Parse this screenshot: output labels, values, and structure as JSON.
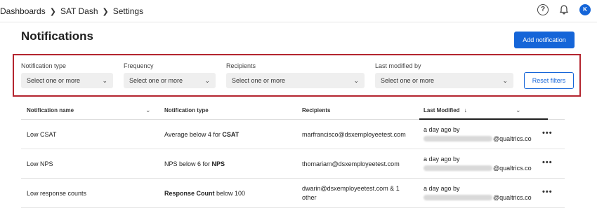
{
  "breadcrumb": {
    "items": [
      "Dashboards",
      "SAT Dash",
      "Settings"
    ]
  },
  "header_icons": {
    "help": "question-circle-icon",
    "bell": "bell-icon",
    "avatar_initial": "K"
  },
  "page": {
    "title": "Notifications",
    "add_button": "Add notification"
  },
  "filters": {
    "notification_type": {
      "label": "Notification type",
      "placeholder": "Select one or more"
    },
    "frequency": {
      "label": "Frequency",
      "placeholder": "Select one or more"
    },
    "recipients": {
      "label": "Recipients",
      "placeholder": "Select one or more"
    },
    "last_modified_by": {
      "label": "Last modified by",
      "placeholder": "Select one or more"
    },
    "reset_button": "Reset filters"
  },
  "table": {
    "columns": {
      "name": "Notification name",
      "type": "Notification type",
      "recipients": "Recipients",
      "modified": "Last Modified",
      "sort_arrow": "↓"
    },
    "rows": [
      {
        "name": "Low CSAT",
        "type_prefix": "Average below 4 for ",
        "type_bold": "CSAT",
        "type_suffix": "",
        "recipients": "marfrancisco@dsxemployeetest.com",
        "recipients_line2": "",
        "modified_line1": "a day ago by",
        "modified_domain": "@qualtrics.co"
      },
      {
        "name": "Low NPS",
        "type_prefix": "NPS below 6 for ",
        "type_bold": "NPS",
        "type_suffix": "",
        "recipients": "thomariam@dsxemployeetest.com",
        "recipients_line2": "",
        "modified_line1": "a day ago by",
        "modified_domain": "@qualtrics.co"
      },
      {
        "name": "Low response counts",
        "type_prefix": "",
        "type_bold": "Response Count",
        "type_suffix": " below 100",
        "recipients": "dwarin@dsxemployeetest.com & 1",
        "recipients_line2": "other",
        "modified_line1": "a day ago by",
        "modified_domain": "@qualtrics.co"
      }
    ],
    "more_label": "•••"
  }
}
